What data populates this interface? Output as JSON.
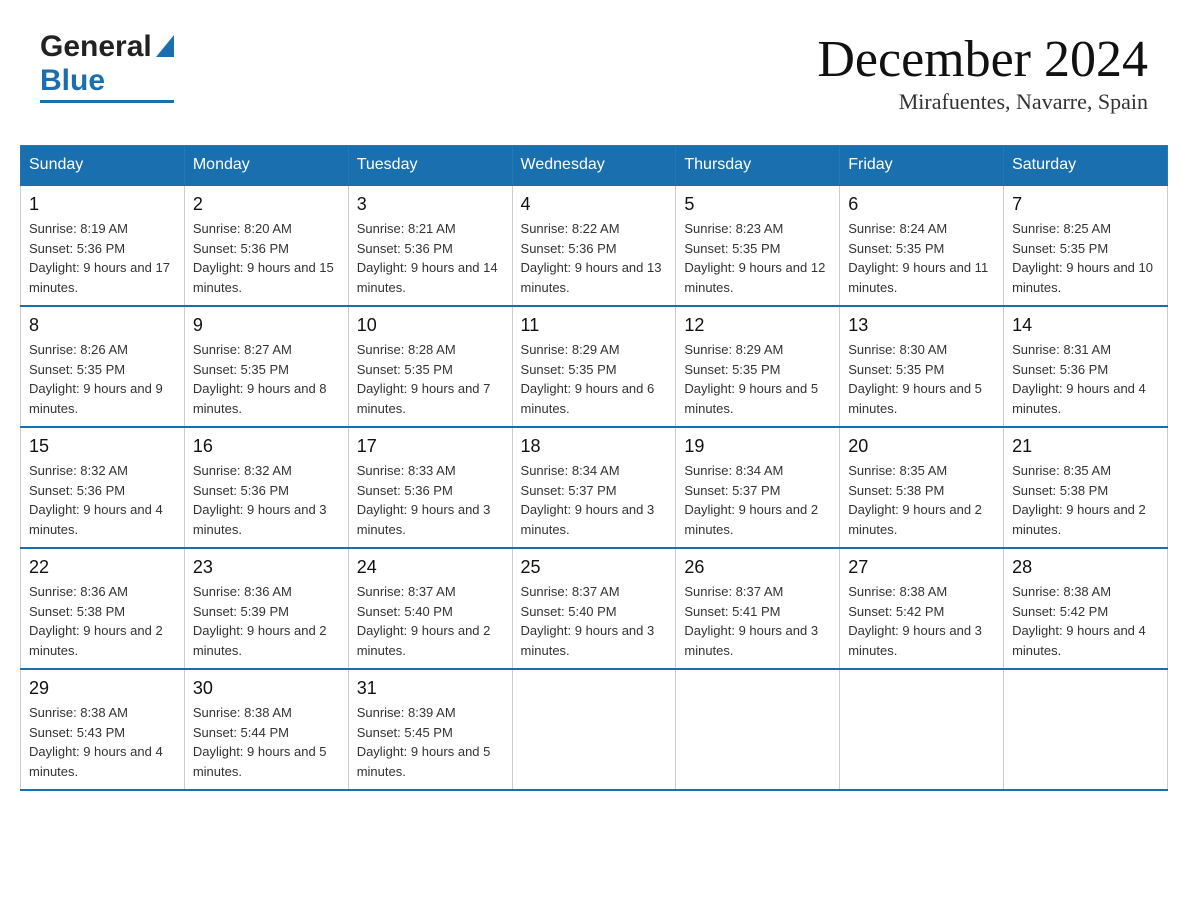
{
  "logo": {
    "general": "General",
    "blue": "Blue",
    "triangle": "▶"
  },
  "header": {
    "month": "December 2024",
    "location": "Mirafuentes, Navarre, Spain"
  },
  "weekdays": [
    "Sunday",
    "Monday",
    "Tuesday",
    "Wednesday",
    "Thursday",
    "Friday",
    "Saturday"
  ],
  "weeks": [
    [
      {
        "day": "1",
        "sunrise": "Sunrise: 8:19 AM",
        "sunset": "Sunset: 5:36 PM",
        "daylight": "Daylight: 9 hours and 17 minutes."
      },
      {
        "day": "2",
        "sunrise": "Sunrise: 8:20 AM",
        "sunset": "Sunset: 5:36 PM",
        "daylight": "Daylight: 9 hours and 15 minutes."
      },
      {
        "day": "3",
        "sunrise": "Sunrise: 8:21 AM",
        "sunset": "Sunset: 5:36 PM",
        "daylight": "Daylight: 9 hours and 14 minutes."
      },
      {
        "day": "4",
        "sunrise": "Sunrise: 8:22 AM",
        "sunset": "Sunset: 5:36 PM",
        "daylight": "Daylight: 9 hours and 13 minutes."
      },
      {
        "day": "5",
        "sunrise": "Sunrise: 8:23 AM",
        "sunset": "Sunset: 5:35 PM",
        "daylight": "Daylight: 9 hours and 12 minutes."
      },
      {
        "day": "6",
        "sunrise": "Sunrise: 8:24 AM",
        "sunset": "Sunset: 5:35 PM",
        "daylight": "Daylight: 9 hours and 11 minutes."
      },
      {
        "day": "7",
        "sunrise": "Sunrise: 8:25 AM",
        "sunset": "Sunset: 5:35 PM",
        "daylight": "Daylight: 9 hours and 10 minutes."
      }
    ],
    [
      {
        "day": "8",
        "sunrise": "Sunrise: 8:26 AM",
        "sunset": "Sunset: 5:35 PM",
        "daylight": "Daylight: 9 hours and 9 minutes."
      },
      {
        "day": "9",
        "sunrise": "Sunrise: 8:27 AM",
        "sunset": "Sunset: 5:35 PM",
        "daylight": "Daylight: 9 hours and 8 minutes."
      },
      {
        "day": "10",
        "sunrise": "Sunrise: 8:28 AM",
        "sunset": "Sunset: 5:35 PM",
        "daylight": "Daylight: 9 hours and 7 minutes."
      },
      {
        "day": "11",
        "sunrise": "Sunrise: 8:29 AM",
        "sunset": "Sunset: 5:35 PM",
        "daylight": "Daylight: 9 hours and 6 minutes."
      },
      {
        "day": "12",
        "sunrise": "Sunrise: 8:29 AM",
        "sunset": "Sunset: 5:35 PM",
        "daylight": "Daylight: 9 hours and 5 minutes."
      },
      {
        "day": "13",
        "sunrise": "Sunrise: 8:30 AM",
        "sunset": "Sunset: 5:35 PM",
        "daylight": "Daylight: 9 hours and 5 minutes."
      },
      {
        "day": "14",
        "sunrise": "Sunrise: 8:31 AM",
        "sunset": "Sunset: 5:36 PM",
        "daylight": "Daylight: 9 hours and 4 minutes."
      }
    ],
    [
      {
        "day": "15",
        "sunrise": "Sunrise: 8:32 AM",
        "sunset": "Sunset: 5:36 PM",
        "daylight": "Daylight: 9 hours and 4 minutes."
      },
      {
        "day": "16",
        "sunrise": "Sunrise: 8:32 AM",
        "sunset": "Sunset: 5:36 PM",
        "daylight": "Daylight: 9 hours and 3 minutes."
      },
      {
        "day": "17",
        "sunrise": "Sunrise: 8:33 AM",
        "sunset": "Sunset: 5:36 PM",
        "daylight": "Daylight: 9 hours and 3 minutes."
      },
      {
        "day": "18",
        "sunrise": "Sunrise: 8:34 AM",
        "sunset": "Sunset: 5:37 PM",
        "daylight": "Daylight: 9 hours and 3 minutes."
      },
      {
        "day": "19",
        "sunrise": "Sunrise: 8:34 AM",
        "sunset": "Sunset: 5:37 PM",
        "daylight": "Daylight: 9 hours and 2 minutes."
      },
      {
        "day": "20",
        "sunrise": "Sunrise: 8:35 AM",
        "sunset": "Sunset: 5:38 PM",
        "daylight": "Daylight: 9 hours and 2 minutes."
      },
      {
        "day": "21",
        "sunrise": "Sunrise: 8:35 AM",
        "sunset": "Sunset: 5:38 PM",
        "daylight": "Daylight: 9 hours and 2 minutes."
      }
    ],
    [
      {
        "day": "22",
        "sunrise": "Sunrise: 8:36 AM",
        "sunset": "Sunset: 5:38 PM",
        "daylight": "Daylight: 9 hours and 2 minutes."
      },
      {
        "day": "23",
        "sunrise": "Sunrise: 8:36 AM",
        "sunset": "Sunset: 5:39 PM",
        "daylight": "Daylight: 9 hours and 2 minutes."
      },
      {
        "day": "24",
        "sunrise": "Sunrise: 8:37 AM",
        "sunset": "Sunset: 5:40 PM",
        "daylight": "Daylight: 9 hours and 2 minutes."
      },
      {
        "day": "25",
        "sunrise": "Sunrise: 8:37 AM",
        "sunset": "Sunset: 5:40 PM",
        "daylight": "Daylight: 9 hours and 3 minutes."
      },
      {
        "day": "26",
        "sunrise": "Sunrise: 8:37 AM",
        "sunset": "Sunset: 5:41 PM",
        "daylight": "Daylight: 9 hours and 3 minutes."
      },
      {
        "day": "27",
        "sunrise": "Sunrise: 8:38 AM",
        "sunset": "Sunset: 5:42 PM",
        "daylight": "Daylight: 9 hours and 3 minutes."
      },
      {
        "day": "28",
        "sunrise": "Sunrise: 8:38 AM",
        "sunset": "Sunset: 5:42 PM",
        "daylight": "Daylight: 9 hours and 4 minutes."
      }
    ],
    [
      {
        "day": "29",
        "sunrise": "Sunrise: 8:38 AM",
        "sunset": "Sunset: 5:43 PM",
        "daylight": "Daylight: 9 hours and 4 minutes."
      },
      {
        "day": "30",
        "sunrise": "Sunrise: 8:38 AM",
        "sunset": "Sunset: 5:44 PM",
        "daylight": "Daylight: 9 hours and 5 minutes."
      },
      {
        "day": "31",
        "sunrise": "Sunrise: 8:39 AM",
        "sunset": "Sunset: 5:45 PM",
        "daylight": "Daylight: 9 hours and 5 minutes."
      },
      null,
      null,
      null,
      null
    ]
  ]
}
